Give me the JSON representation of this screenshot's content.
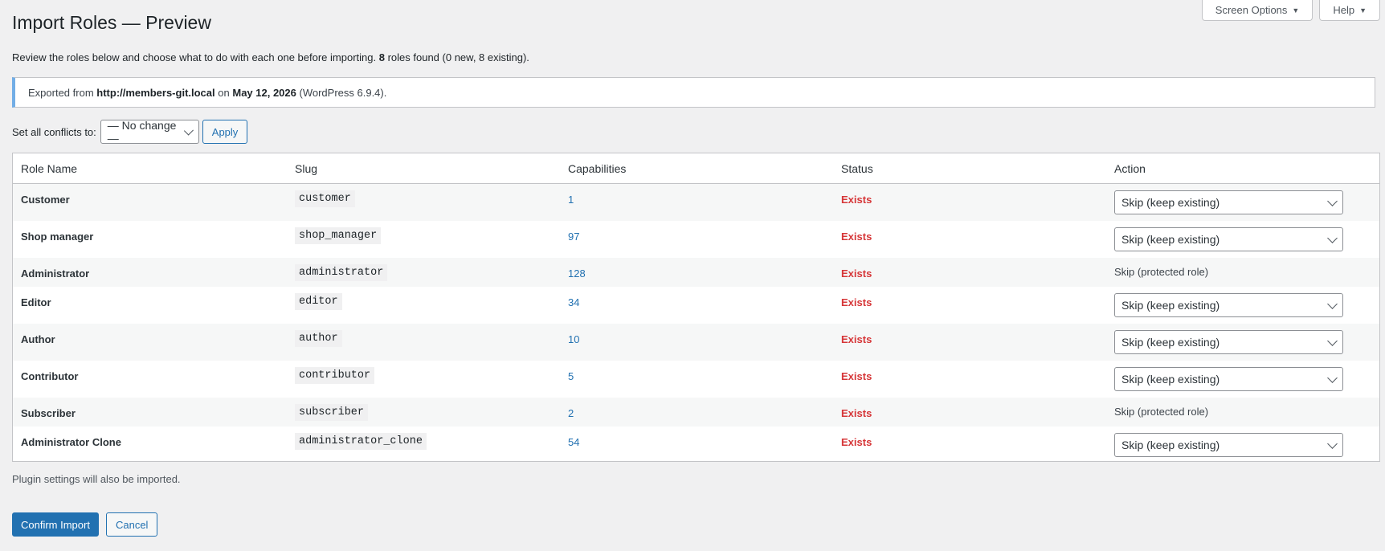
{
  "screen_meta": {
    "screen_options": "Screen Options",
    "help": "Help"
  },
  "page": {
    "title": "Import Roles — Preview",
    "desc_before": "Review the roles below and choose what to do with each one before importing.",
    "desc_count": "8",
    "desc_after": "roles found (0 new, 8 existing)."
  },
  "notice": {
    "prefix": "Exported from",
    "site": "http://members-git.local",
    "mid": "on",
    "date": "May 12, 2026",
    "suffix": "(WordPress 6.9.4)."
  },
  "bulk": {
    "label": "Set all conflicts to:",
    "selected": "— No change —",
    "apply": "Apply"
  },
  "table": {
    "headers": [
      "Role Name",
      "Slug",
      "Capabilities",
      "Status",
      "Action"
    ],
    "rows": [
      {
        "name": "Customer",
        "slug": "customer",
        "caps": "1",
        "status": "Exists",
        "action": "Skip (keep existing)"
      },
      {
        "name": "Shop manager",
        "slug": "shop_manager",
        "caps": "97",
        "status": "Exists",
        "action": "Skip (keep existing)"
      },
      {
        "name": "Administrator",
        "slug": "administrator",
        "caps": "128",
        "status": "Exists",
        "action": "Skip (protected role)"
      },
      {
        "name": "Editor",
        "slug": "editor",
        "caps": "34",
        "status": "Exists",
        "action": "Skip (keep existing)"
      },
      {
        "name": "Author",
        "slug": "author",
        "caps": "10",
        "status": "Exists",
        "action": "Skip (keep existing)"
      },
      {
        "name": "Contributor",
        "slug": "contributor",
        "caps": "5",
        "status": "Exists",
        "action": "Skip (keep existing)"
      },
      {
        "name": "Subscriber",
        "slug": "subscriber",
        "caps": "2",
        "status": "Exists",
        "action": "Skip (protected role)"
      },
      {
        "name": "Administrator Clone",
        "slug": "administrator_clone",
        "caps": "54",
        "status": "Exists",
        "action": "Skip (keep existing)"
      }
    ]
  },
  "footer": {
    "note": "Plugin settings will also be imported.",
    "confirm": "Confirm Import",
    "cancel": "Cancel"
  },
  "colors": {
    "primary": "#2271b1",
    "status_exists": "#d63638",
    "notice_border": "#72aee6"
  }
}
